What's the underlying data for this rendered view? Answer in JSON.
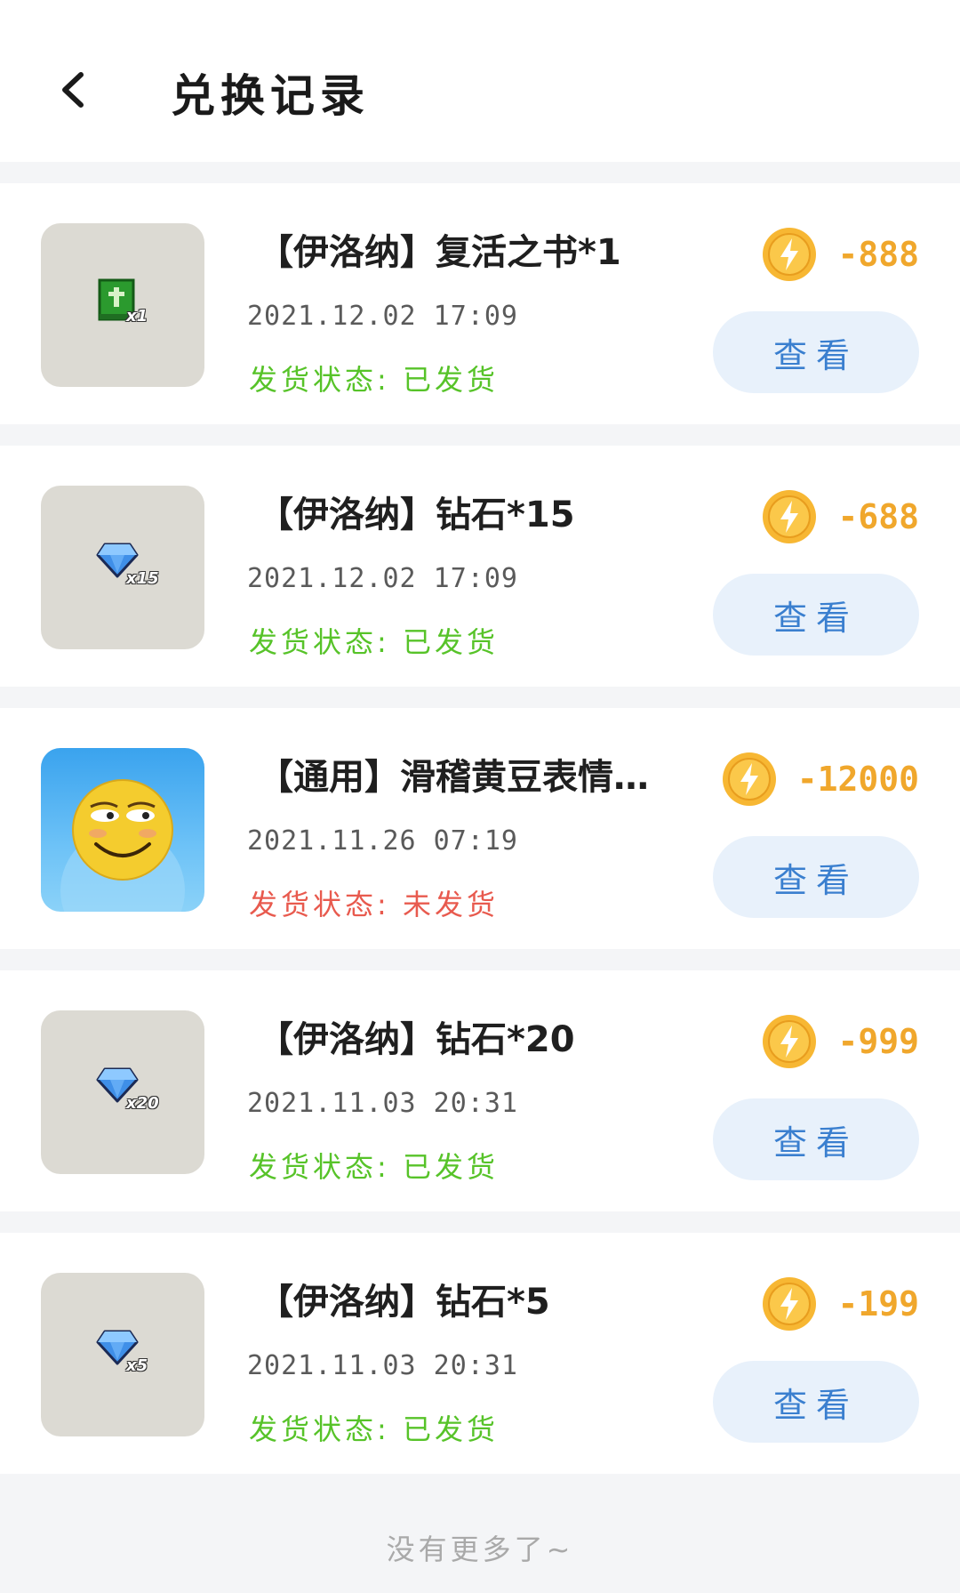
{
  "header": {
    "title": "兑换记录",
    "back_icon": "chevron-left-icon"
  },
  "records": [
    {
      "title": "【伊洛纳】复活之书*1",
      "date": "2021.12.02 17:09",
      "status_label": "发货状态:",
      "status": "已发货",
      "cost": "-888",
      "view_label": "查看",
      "thumb_icon": "green-book-icon",
      "thumb_qty": "x1"
    },
    {
      "title": "【伊洛纳】钻石*15",
      "date": "2021.12.02 17:09",
      "status_label": "发货状态:",
      "status": "已发货",
      "cost": "-688",
      "view_label": "查看",
      "thumb_icon": "diamond-icon",
      "thumb_qty": "x15"
    },
    {
      "title": "【通用】滑稽黄豆表情…",
      "date": "2021.11.26 07:19",
      "status_label": "发货状态:",
      "status": "未发货",
      "cost": "-12000",
      "view_label": "查看",
      "thumb_icon": "smirk-emoji-icon",
      "thumb_qty": ""
    },
    {
      "title": "【伊洛纳】钻石*20",
      "date": "2021.11.03 20:31",
      "status_label": "发货状态:",
      "status": "已发货",
      "cost": "-999",
      "view_label": "查看",
      "thumb_icon": "diamond-icon",
      "thumb_qty": "x20"
    },
    {
      "title": "【伊洛纳】钻石*5",
      "date": "2021.11.03 20:31",
      "status_label": "发货状态:",
      "status": "已发货",
      "cost": "-199",
      "view_label": "查看",
      "thumb_icon": "diamond-icon",
      "thumb_qty": "x5"
    }
  ],
  "footer": {
    "no_more": "没有更多了~"
  },
  "colors": {
    "shipped": "#57c329",
    "pending": "#e85a4e",
    "coin": "#f0a72c",
    "view_button_bg": "#e8f1fb",
    "view_button_text": "#3a7fcf"
  }
}
